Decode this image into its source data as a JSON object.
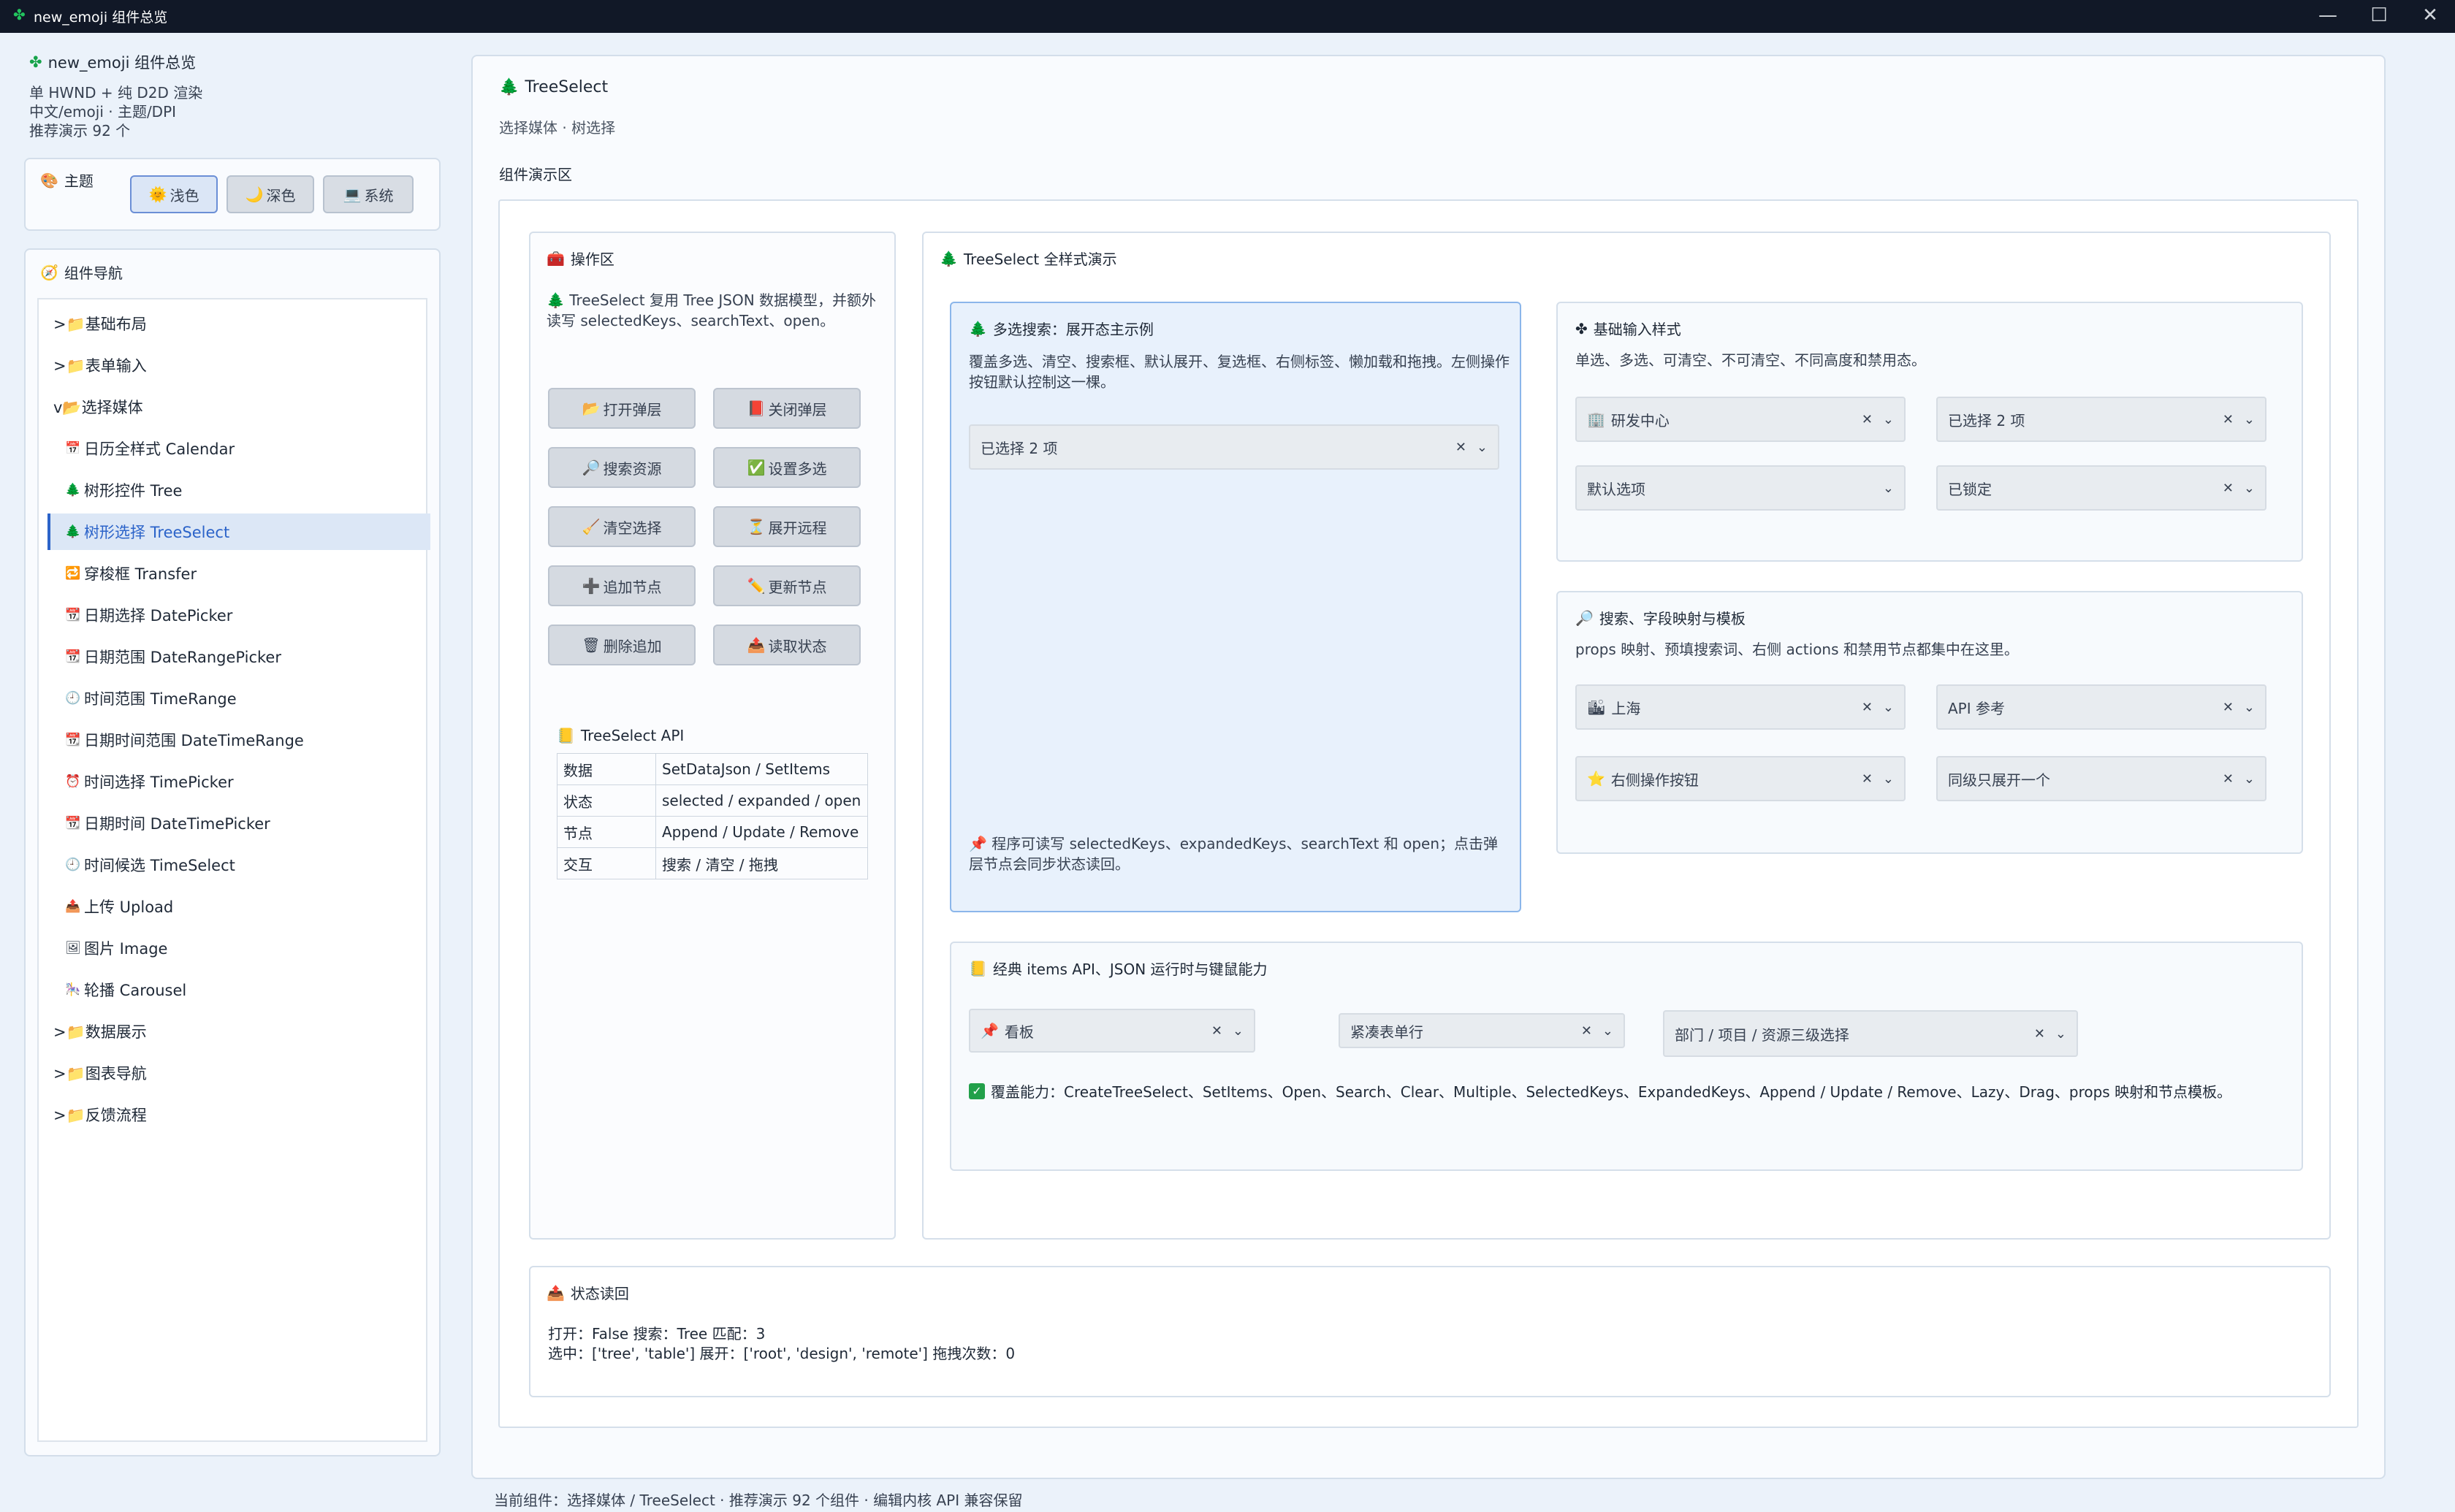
{
  "window": {
    "title": "new_emoji 组件总览",
    "icon": "clover-icon"
  },
  "sidebar": {
    "app_title": "new_emoji 组件总览",
    "info_lines": [
      "单 HWND + 纯 D2D 渲染",
      "中文/emoji · 主题/DPI",
      "推荐演示 92 个"
    ],
    "theme": {
      "title": "主题",
      "buttons": [
        {
          "label": "浅色",
          "icon": "sun-icon",
          "active": true
        },
        {
          "label": "深色",
          "icon": "moon-icon",
          "active": false
        },
        {
          "label": "系统",
          "icon": "computer-icon",
          "active": false
        }
      ]
    },
    "nav": {
      "title": "组件导航",
      "items": [
        {
          "label": ">📁基础布局",
          "level": 0
        },
        {
          "label": ">📁表单输入",
          "level": 0
        },
        {
          "label": "v📂选择媒体",
          "level": 0
        },
        {
          "label": "日历全样式 Calendar",
          "icon": "📅",
          "level": 1
        },
        {
          "label": "树形控件 Tree",
          "icon": "🌲",
          "level": 1
        },
        {
          "label": "树形选择 TreeSelect",
          "icon": "🌲",
          "level": 1,
          "active": true
        },
        {
          "label": "穿梭框 Transfer",
          "icon": "🔁",
          "level": 1
        },
        {
          "label": "日期选择 DatePicker",
          "icon": "📆",
          "level": 1
        },
        {
          "label": "日期范围 DateRangePicker",
          "icon": "📆",
          "level": 1
        },
        {
          "label": "时间范围 TimeRange",
          "icon": "🕘",
          "level": 1
        },
        {
          "label": "日期时间范围 DateTimeRange",
          "icon": "📆",
          "level": 1
        },
        {
          "label": "时间选择 TimePicker",
          "icon": "⏰",
          "level": 1
        },
        {
          "label": "日期时间 DateTimePicker",
          "icon": "📆",
          "level": 1
        },
        {
          "label": "时间候选 TimeSelect",
          "icon": "🕘",
          "level": 1
        },
        {
          "label": "上传 Upload",
          "icon": "📤",
          "level": 1
        },
        {
          "label": "图片 Image",
          "icon": "🖼",
          "level": 1
        },
        {
          "label": "轮播 Carousel",
          "icon": "🎠",
          "level": 1
        },
        {
          "label": ">📁数据展示",
          "level": 0
        },
        {
          "label": ">📁图表导航",
          "level": 0
        },
        {
          "label": ">📁反馈流程",
          "level": 0
        }
      ]
    }
  },
  "main": {
    "title": "TreeSelect",
    "subtitle": "选择媒体 · 树选择",
    "demo_area_label": "组件演示区",
    "ops": {
      "title": "操作区",
      "desc": "TreeSelect 复用 Tree JSON 数据模型，并额外读写 selectedKeys、searchText、open。",
      "buttons": [
        {
          "label": "打开弹层",
          "icon": "📂"
        },
        {
          "label": "关闭弹层",
          "icon": "📕"
        },
        {
          "label": "搜索资源",
          "icon": "🔎"
        },
        {
          "label": "设置多选",
          "icon": "✅"
        },
        {
          "label": "清空选择",
          "icon": "🧹"
        },
        {
          "label": "展开远程",
          "icon": "⏳"
        },
        {
          "label": "追加节点",
          "icon": "➕"
        },
        {
          "label": "更新节点",
          "icon": "✏️"
        },
        {
          "label": "删除追加",
          "icon": "🗑"
        },
        {
          "label": "读取状态",
          "icon": "📤"
        }
      ],
      "api": {
        "title": "TreeSelect API",
        "rows": [
          [
            "数据",
            "SetDataJson / SetItems"
          ],
          [
            "状态",
            "selected / expanded / open"
          ],
          [
            "节点",
            "Append / Update / Remove"
          ],
          [
            "交互",
            "搜索 / 清空 / 拖拽"
          ]
        ]
      }
    },
    "showcase": {
      "title": "TreeSelect 全样式演示",
      "multi": {
        "title": "多选搜索：展开态主示例",
        "desc": "覆盖多选、清空、搜索框、默认展开、复选框、右侧标签、懒加载和拖拽。左侧操作按钮默认控制这一棵。",
        "value": "已选择 2 项",
        "note": "程序可读写 selectedKeys、expandedKeys、searchText 和 open；点击弹层节点会同步状态读回。"
      },
      "basic": {
        "title": "基础输入样式",
        "desc": "单选、多选、可清空、不可清空、不同高度和禁用态。",
        "fields": [
          {
            "value": "研发中心",
            "icon": "🏢",
            "clear": true
          },
          {
            "value": "已选择 2 项",
            "icon": "",
            "clear": true
          },
          {
            "value": "默认选项",
            "icon": "",
            "clear": false
          },
          {
            "value": "已锁定",
            "icon": "",
            "clear": true
          }
        ]
      },
      "search": {
        "title": "搜索、字段映射与模板",
        "desc": "props 映射、预填搜索词、右侧 actions 和禁用节点都集中在这里。",
        "fields": [
          {
            "value": "上海",
            "icon": "🏙",
            "clear": true
          },
          {
            "value": "API 参考",
            "icon": "",
            "clear": true
          },
          {
            "value": "右侧操作按钮",
            "icon": "⭐",
            "clear": true
          },
          {
            "value": "同级只展开一个",
            "icon": "",
            "clear": true
          }
        ]
      },
      "classic": {
        "title": "经典 items API、JSON 运行时与键鼠能力",
        "fields": [
          {
            "value": "看板",
            "icon": "📌",
            "clear": true
          },
          {
            "value": "紧凑表单行",
            "icon": "",
            "clear": true
          },
          {
            "value": "部门 / 项目 / 资源三级选择",
            "icon": "",
            "clear": true
          }
        ],
        "coverage": "覆盖能力：CreateTreeSelect、SetItems、Open、Search、Clear、Multiple、SelectedKeys、ExpandedKeys、Append / Update / Remove、Lazy、Drag、props 映射和节点模板。"
      }
    },
    "status": {
      "title": "状态读回",
      "line1": "打开：False  搜索：Tree  匹配：3",
      "line2": "选中：['tree', 'table']  展开：['root', 'design', 'remote']  拖拽次数：0"
    },
    "footer": "当前组件：选择媒体 / TreeSelect · 推荐演示 92 个组件 · 编辑内核 API 兼容保留"
  }
}
